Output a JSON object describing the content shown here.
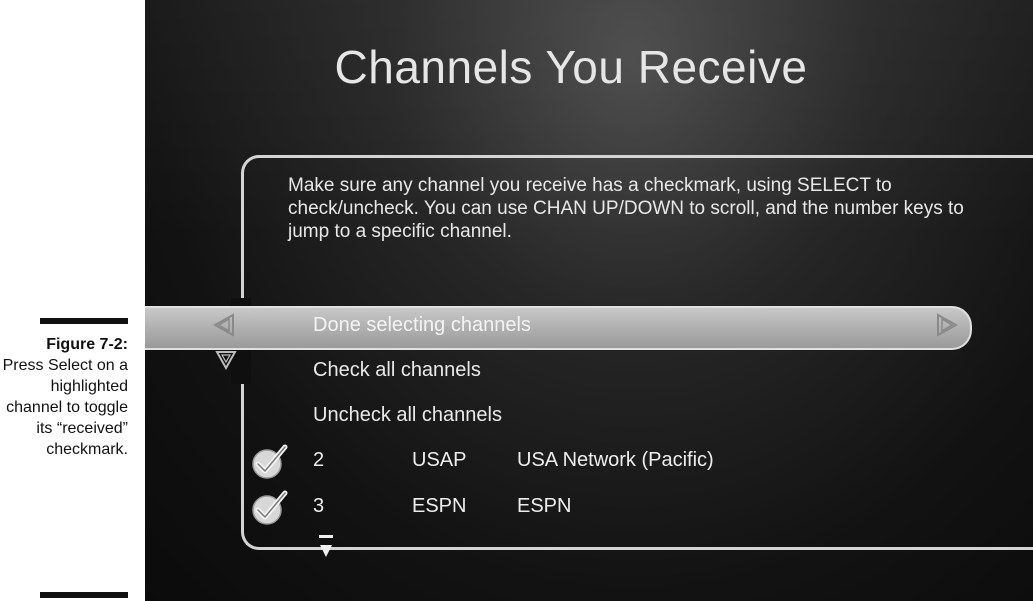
{
  "caption": {
    "figure_label": "Figure 7-2:",
    "text": "Press Select on a highlighted channel to toggle its “received” checkmark."
  },
  "screen": {
    "title": "Channels You Receive",
    "instructions": "Make sure any channel you receive has a checkmark, using SELECT to check/uncheck. You can use CHAN UP/DOWN to scroll, and the number keys to jump to a specific channel.",
    "menu": [
      {
        "label": "Done selecting channels",
        "selected": true
      },
      {
        "label": "Check all channels",
        "selected": false
      },
      {
        "label": "Uncheck all channels",
        "selected": false
      }
    ],
    "channels": [
      {
        "number": "2",
        "callsign": "USAP",
        "name": "USA Network (Pacific)",
        "checked": true
      },
      {
        "number": "3",
        "callsign": "ESPN",
        "name": "ESPN",
        "checked": true
      }
    ]
  },
  "icons": {
    "left_arrow": "left-arrow-icon",
    "right_arrow": "right-arrow-icon",
    "up_outline_arrow": "down-outline-arrow-icon",
    "checkmark": "checkmark-icon",
    "scroll_down": "scroll-down-icon"
  },
  "colors": {
    "screen_bg": "#121212",
    "highlight": "#b0b0b0",
    "text": "#e8e8e8"
  }
}
